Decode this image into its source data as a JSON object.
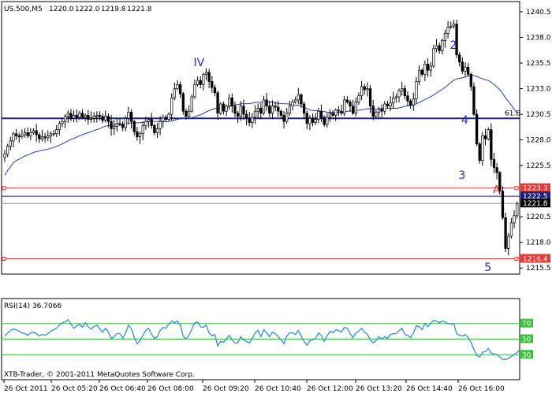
{
  "chart_data": {
    "type": "candlestick",
    "symbol_line": "US.500,M5",
    "ohlc_header": [
      "1220.0",
      "1222.0",
      "1219.8",
      "1221.8"
    ],
    "x_tick_labels": [
      "26 Oct 2011",
      "26 Oct 05:20",
      "26 Oct 06:40",
      "26 Oct 08:00",
      "26 Oct 09:20",
      "26 Oct 10:40",
      "26 Oct 12:00",
      "26 Oct 13:20",
      "26 Oct 14:40",
      "26 Oct 16:00"
    ],
    "y_ticks": [
      1240.5,
      1238.0,
      1235.5,
      1233.0,
      1230.5,
      1228.0,
      1225.5,
      1220.5,
      1218.0,
      1215.5
    ],
    "y_tick_labels": [
      "1240.5",
      "1238.0",
      "1235.5",
      "1233.0",
      "1230.5",
      "1228.0",
      "1225.5",
      "1220.5",
      "1218.0",
      "1215.5"
    ],
    "ylim": [
      1214.9,
      1241.5
    ],
    "levels": [
      {
        "value": 1230.1,
        "color": "#1a237e",
        "label": "61.8"
      },
      {
        "value": 1223.3,
        "color": "#e53935",
        "label": "1223.3"
      },
      {
        "value": 1216.4,
        "color": "#e53935",
        "label": "1216.4"
      }
    ],
    "price_labels": [
      {
        "value": 1222.5,
        "label": "1222.5",
        "bg": "#1a237e"
      },
      {
        "value": 1221.8,
        "label": "1221.8",
        "bg": "#000000"
      }
    ],
    "close": [
      1226.6,
      1227.4,
      1227.9,
      1228.6,
      1228.4,
      1228.3,
      1228.5,
      1228.7,
      1228.4,
      1228.7,
      1228.9,
      1228.5,
      1228.1,
      1228.3,
      1228.2,
      1228.4,
      1228.6,
      1228.6,
      1229.0,
      1229.6,
      1229.8,
      1230.3,
      1230.6,
      1230.1,
      1230.4,
      1230.2,
      1230.6,
      1230.2,
      1230.4,
      1230.0,
      1230.1,
      1230.3,
      1230.4,
      1230.3,
      1229.9,
      1230.3,
      1229.8,
      1229.1,
      1229.3,
      1229.6,
      1229.5,
      1229.2,
      1230.1,
      1230.7,
      1229.8,
      1228.8,
      1228.3,
      1228.6,
      1229.4,
      1229.8,
      1230.0,
      1229.4,
      1228.7,
      1229.1,
      1229.8,
      1230.2,
      1230.0,
      1230.5,
      1232.1,
      1233.0,
      1233.4,
      1232.5,
      1230.8,
      1230.3,
      1230.8,
      1232.2,
      1233.4,
      1233.8,
      1233.4,
      1234.4,
      1234.6,
      1233.7,
      1233.1,
      1232.6,
      1230.6,
      1231.5,
      1230.8,
      1231.3,
      1232.1,
      1231.3,
      1230.6,
      1230.3,
      1231.3,
      1230.5,
      1230.1,
      1229.7,
      1230.2,
      1230.8,
      1231.1,
      1230.6,
      1231.9,
      1231.3,
      1230.6,
      1231.3,
      1231.2,
      1230.8,
      1230.4,
      1229.8,
      1230.6,
      1231.3,
      1231.7,
      1231.9,
      1232.4,
      1231.5,
      1230.6,
      1229.6,
      1230.1,
      1229.7,
      1230.0,
      1230.8,
      1230.2,
      1229.5,
      1230.2,
      1230.6,
      1230.4,
      1230.9,
      1230.8,
      1230.6,
      1231.9,
      1231.7,
      1231.3,
      1230.6,
      1231.7,
      1232.3,
      1233.2,
      1232.9,
      1233.0,
      1231.3,
      1230.3,
      1230.7,
      1231.0,
      1230.8,
      1231.5,
      1231.3,
      1231.6,
      1232.1,
      1232.2,
      1232.8,
      1233.0,
      1232.3,
      1231.8,
      1231.4,
      1232.0,
      1233.7,
      1234.8,
      1234.4,
      1235.4,
      1234.8,
      1235.2,
      1236.9,
      1237.2,
      1236.7,
      1237.7,
      1238.4,
      1239.0,
      1239.1,
      1239.3,
      1236.3,
      1235.6,
      1234.7,
      1235.1,
      1234.4,
      1233.2,
      1230.5,
      1227.6,
      1226.0,
      1228.4,
      1228.1,
      1229.0,
      1226.1,
      1225.3,
      1224.8,
      1223.0,
      1220.4,
      1217.4,
      1218.6,
      1219.9,
      1220.6,
      1221.8
    ],
    "ma_label": "MA",
    "rsi": {
      "label": "RSI(14) 36.7066",
      "ylim": [
        0,
        100
      ],
      "levels": [
        70,
        50,
        30
      ],
      "level_labels": [
        "70",
        "50",
        "30"
      ],
      "values": [
        54,
        58,
        61,
        63,
        62,
        60,
        58,
        57,
        55,
        58,
        59,
        57,
        54,
        56,
        55,
        57,
        60,
        62,
        64,
        68,
        71,
        72,
        75,
        69,
        64,
        67,
        69,
        65,
        71,
        66,
        63,
        66,
        68,
        63,
        59,
        64,
        59,
        51,
        53,
        57,
        57,
        51,
        58,
        68,
        63,
        52,
        44,
        48,
        55,
        61,
        64,
        56,
        51,
        53,
        61,
        65,
        64,
        69,
        73,
        71,
        73,
        68,
        54,
        50,
        55,
        63,
        71,
        72,
        66,
        65,
        68,
        58,
        54,
        56,
        41,
        47,
        46,
        50,
        55,
        49,
        45,
        45,
        53,
        49,
        47,
        45,
        51,
        58,
        61,
        53,
        62,
        58,
        53,
        59,
        57,
        53,
        49,
        44,
        54,
        58,
        58,
        56,
        61,
        54,
        47,
        42,
        48,
        49,
        51,
        58,
        55,
        47,
        54,
        60,
        58,
        62,
        61,
        59,
        65,
        64,
        57,
        52,
        58,
        60,
        64,
        59,
        56,
        49,
        45,
        48,
        53,
        50,
        53,
        51,
        56,
        57,
        57,
        61,
        64,
        56,
        55,
        52,
        58,
        67,
        66,
        62,
        70,
        66,
        70,
        74,
        73,
        71,
        73,
        72,
        70,
        69,
        70,
        57,
        55,
        54,
        56,
        52,
        46,
        37,
        29,
        27,
        33,
        34,
        38,
        32,
        31,
        30,
        27,
        24,
        24,
        25,
        28,
        30,
        33,
        37
      ]
    },
    "annotations": [
      {
        "text": "IV",
        "i": 67,
        "value": 1235.2
      },
      {
        "text": "2",
        "i": 156,
        "value": 1236.9
      },
      {
        "text": "4",
        "i": 160,
        "value": 1229.6
      },
      {
        "text": "3",
        "i": 159,
        "value": 1224.2
      },
      {
        "text": "A",
        "i": 171,
        "value": 1222.8
      },
      {
        "text": "5",
        "i": 168,
        "value": 1215.2
      }
    ]
  },
  "footer": "XTB-Trader, © 2001-2011 MetaQuotes Software Corp."
}
